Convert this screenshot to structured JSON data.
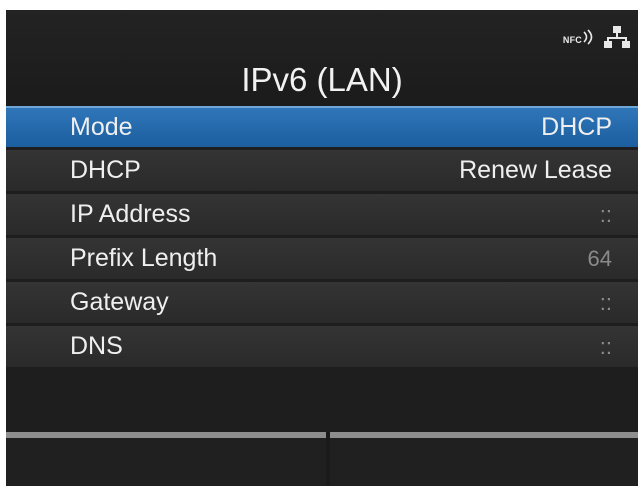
{
  "header": {
    "title": "IPv6 (LAN)",
    "status_icons": {
      "nfc_label": "NFC",
      "nfc_icon": "nfc-wave-icon",
      "lan_icon": "network-lan-icon"
    }
  },
  "menu": {
    "items": [
      {
        "label": "Mode",
        "value": "DHCP",
        "selected": true
      },
      {
        "label": "DHCP",
        "value": "Renew Lease",
        "selected": false
      },
      {
        "label": "IP Address",
        "value": "::",
        "selected": false
      },
      {
        "label": "Prefix Length",
        "value": "64",
        "selected": false
      },
      {
        "label": "Gateway",
        "value": "::",
        "selected": false
      },
      {
        "label": "DNS",
        "value": "::",
        "selected": false
      }
    ]
  },
  "softkeys": {
    "left_label": "",
    "right_label": ""
  },
  "colors": {
    "selection_blue": "#2370b0",
    "row_background": "#303030",
    "screen_background": "#1e1e1e",
    "text": "#efefef"
  }
}
